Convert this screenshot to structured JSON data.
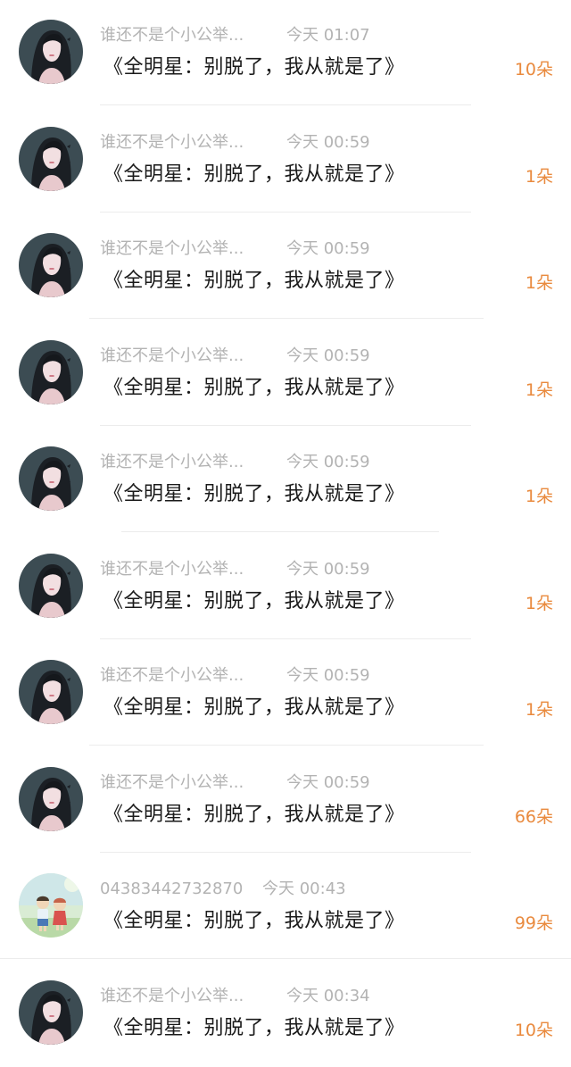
{
  "items": [
    {
      "name": "谁还不是个小公举...",
      "time": "今天 01:07",
      "title": "《全明星：别脱了，我从就是了》",
      "count": "10朵",
      "avatar": "girl-avatar"
    },
    {
      "name": "谁还不是个小公举...",
      "time": "今天 00:59",
      "title": "《全明星：别脱了，我从就是了》",
      "count": "1朵",
      "avatar": "girl-avatar"
    },
    {
      "name": "谁还不是个小公举...",
      "time": "今天 00:59",
      "title": "《全明星：别脱了，我从就是了》",
      "count": "1朵",
      "avatar": "girl-avatar"
    },
    {
      "name": "谁还不是个小公举...",
      "time": "今天 00:59",
      "title": "《全明星：别脱了，我从就是了》",
      "count": "1朵",
      "avatar": "girl-avatar"
    },
    {
      "name": "谁还不是个小公举...",
      "time": "今天 00:59",
      "title": "《全明星：别脱了，我从就是了》",
      "count": "1朵",
      "avatar": "girl-avatar"
    },
    {
      "name": "谁还不是个小公举...",
      "time": "今天 00:59",
      "title": "《全明星：别脱了，我从就是了》",
      "count": "1朵",
      "avatar": "girl-avatar"
    },
    {
      "name": "谁还不是个小公举...",
      "time": "今天 00:59",
      "title": "《全明星：别脱了，我从就是了》",
      "count": "1朵",
      "avatar": "girl-avatar"
    },
    {
      "name": "谁还不是个小公举...",
      "time": "今天 00:59",
      "title": "《全明星：别脱了，我从就是了》",
      "count": "66朵",
      "avatar": "girl-avatar"
    },
    {
      "name": "04383442732870",
      "time": "今天 00:43",
      "title": "《全明星：别脱了，我从就是了》",
      "count": "99朵",
      "avatar": "kids-avatar"
    },
    {
      "name": "谁还不是个小公举...",
      "time": "今天 00:34",
      "title": "《全明星：别脱了，我从就是了》",
      "count": "10朵",
      "avatar": "girl-avatar"
    }
  ],
  "colors": {
    "accent": "#e98a3e",
    "meta": "#b3b3b3",
    "title": "#1a1a1a"
  }
}
